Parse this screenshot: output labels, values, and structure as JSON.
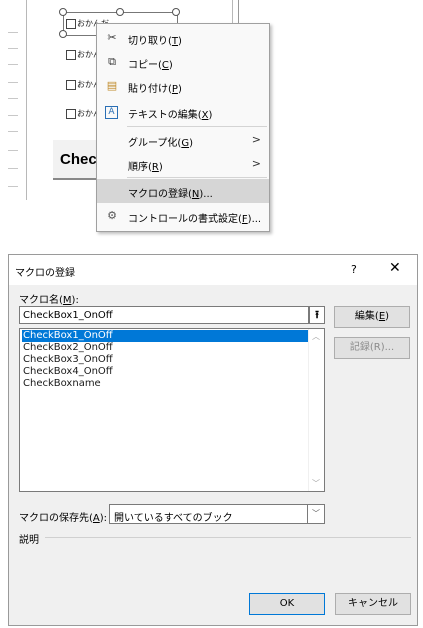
{
  "sheet": {
    "checkbox_label": "おかんだ",
    "checkbox_label_short": "おかん",
    "button_text": "Check"
  },
  "context_menu": {
    "items": [
      {
        "icon": "scissors-icon",
        "glyph": "✂",
        "label": "切り取り(",
        "key": "T",
        "tail": ")",
        "submenu": false
      },
      {
        "icon": "copy-icon",
        "glyph": "⧉",
        "label": "コピー(",
        "key": "C",
        "tail": ")",
        "submenu": false
      },
      {
        "icon": "paste-icon",
        "glyph": "📋",
        "label": "貼り付け(",
        "key": "P",
        "tail": ")",
        "submenu": false
      },
      {
        "icon": "edit-text-icon",
        "glyph": "A",
        "label": "テキストの編集(",
        "key": "X",
        "tail": ")",
        "submenu": false
      },
      {
        "icon": "",
        "glyph": "",
        "label": "グループ化(",
        "key": "G",
        "tail": ")",
        "submenu": true
      },
      {
        "icon": "",
        "glyph": "",
        "label": "順序(",
        "key": "R",
        "tail": ")",
        "submenu": true
      },
      {
        "icon": "",
        "glyph": "",
        "label": "マクロの登録(",
        "key": "N",
        "tail": ")...",
        "submenu": false
      },
      {
        "icon": "format-control-icon",
        "glyph": "⚙",
        "label": "コントロールの書式設定(",
        "key": "F",
        "tail": ")...",
        "submenu": false
      }
    ]
  },
  "dialog": {
    "title": "マクロの登録",
    "help": "?",
    "close": "✕",
    "macro_name_label": "マクロ名(",
    "macro_name_key": "M",
    "macro_name_tail": "):",
    "macro_name_value": "CheckBox1_OnOff",
    "macros": [
      "CheckBox1_OnOff",
      "CheckBox2_OnOff",
      "CheckBox3_OnOff",
      "CheckBox4_OnOff",
      "CheckBoxname"
    ],
    "selected_index": 0,
    "edit_label": "編集(",
    "edit_key": "E",
    "edit_tail": ")",
    "record_label": "記録(R)...",
    "save_in_label": "マクロの保存先(",
    "save_in_key": "A",
    "save_in_tail": "):",
    "save_in_value": "開いているすべてのブック",
    "description_label": "説明",
    "ok_label": "OK",
    "cancel_label": "キャンセル"
  }
}
